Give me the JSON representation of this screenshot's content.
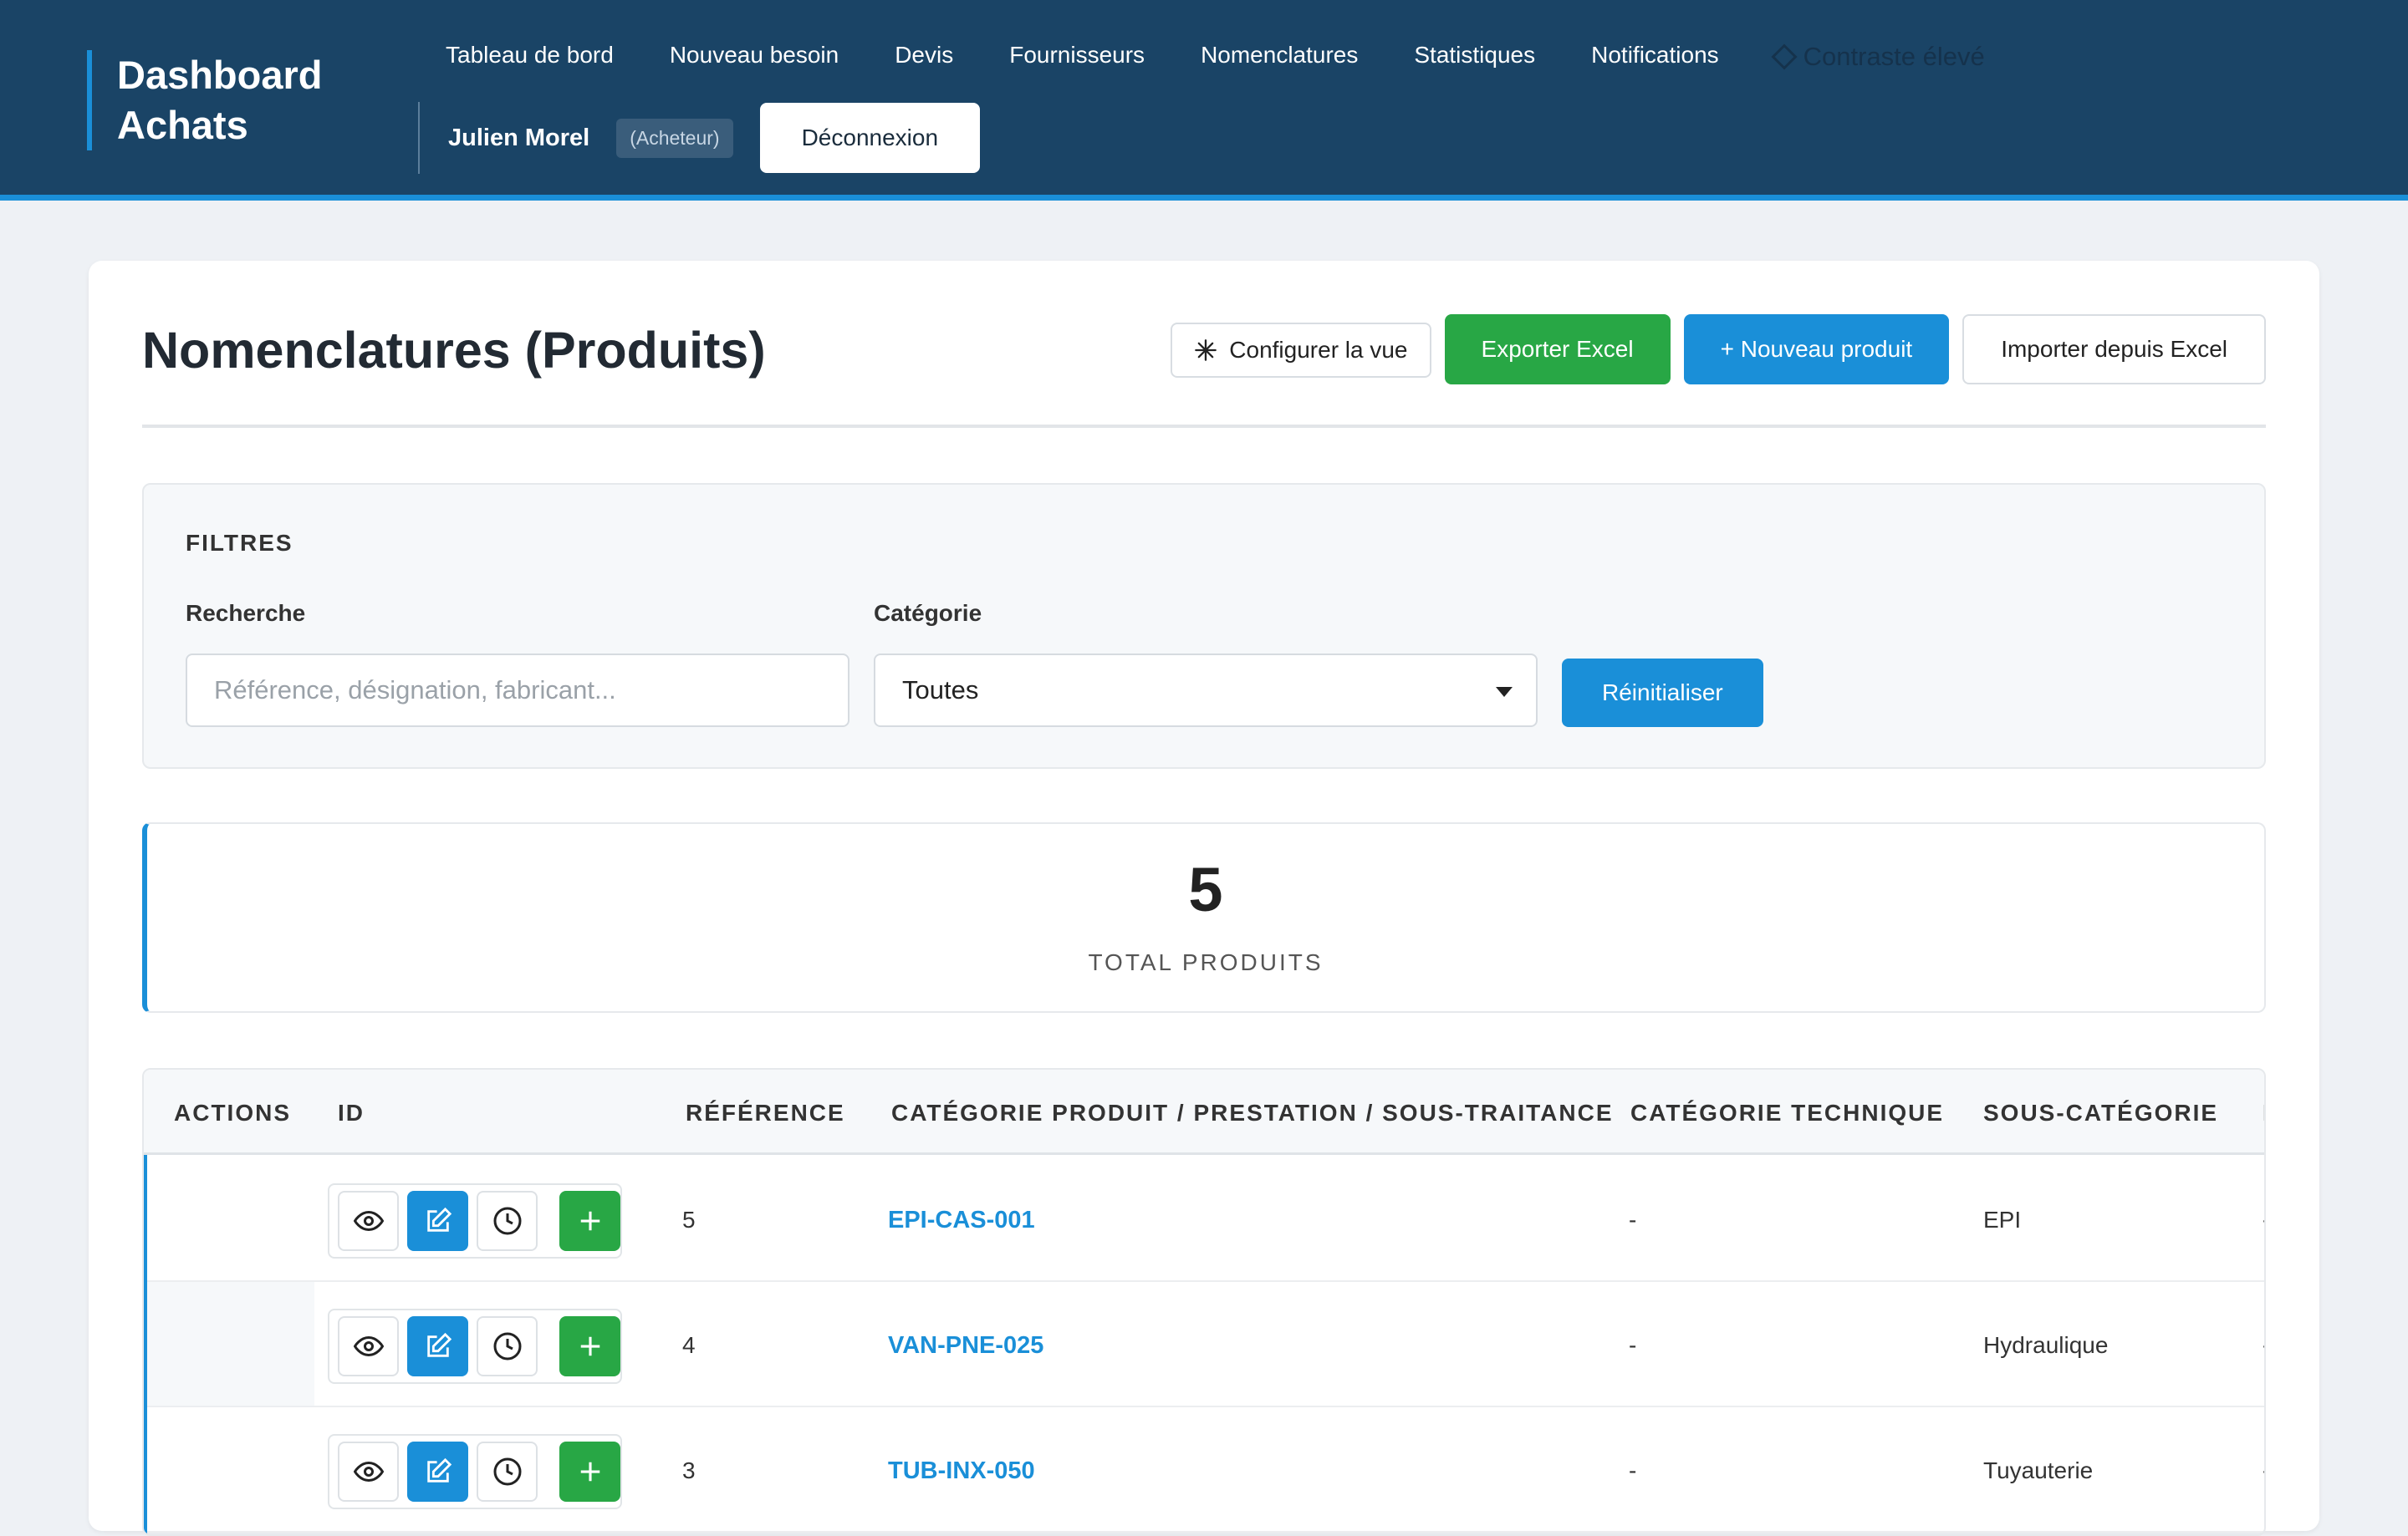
{
  "brand": {
    "line1": "Dashboard",
    "line2": "Achats"
  },
  "nav": [
    {
      "label": "Tableau de bord"
    },
    {
      "label": "Nouveau besoin"
    },
    {
      "label": "Devis"
    },
    {
      "label": "Fournisseurs"
    },
    {
      "label": "Nomenclatures"
    },
    {
      "label": "Statistiques"
    },
    {
      "label": "Notifications"
    }
  ],
  "contrast_label": "Contraste élevé",
  "user": {
    "name": "Julien Morel",
    "role": "(Acheteur)",
    "logout_label": "Déconnexion"
  },
  "page": {
    "title": "Nomenclatures (Produits)",
    "config_label": "Configurer la vue",
    "export_label": "Exporter Excel",
    "new_label": "+ Nouveau produit",
    "import_label": "Importer depuis Excel"
  },
  "filters": {
    "title": "FILTRES",
    "search_label": "Recherche",
    "search_placeholder": "Référence, désignation, fabricant...",
    "category_label": "Catégorie",
    "category_value": "Toutes",
    "reset_label": "Réinitialiser"
  },
  "stat": {
    "value": "5",
    "label": "TOTAL PRODUITS"
  },
  "table": {
    "headers": {
      "actions": "ACTIONS",
      "id": "ID",
      "reference": "RÉFÉRENCE",
      "category": "CATÉGORIE PRODUIT / PRESTATION / SOUS-TRAITANCE",
      "tech": "CATÉGORIE TECHNIQUE",
      "subcat": "SOUS-CATÉGORIE",
      "next": "I"
    },
    "rows": [
      {
        "id": "5",
        "reference": "EPI-CAS-001",
        "category": "-",
        "subcat": "EPI",
        "next": "-"
      },
      {
        "id": "4",
        "reference": "VAN-PNE-025",
        "category": "-",
        "subcat": "Hydraulique",
        "next": "-"
      },
      {
        "id": "3",
        "reference": "TUB-INX-050",
        "category": "-",
        "subcat": "Tuyauterie",
        "next": "-"
      }
    ]
  },
  "colors": {
    "header_bg": "#1a4466",
    "accent": "#1a8fd8",
    "green": "#28a745"
  }
}
